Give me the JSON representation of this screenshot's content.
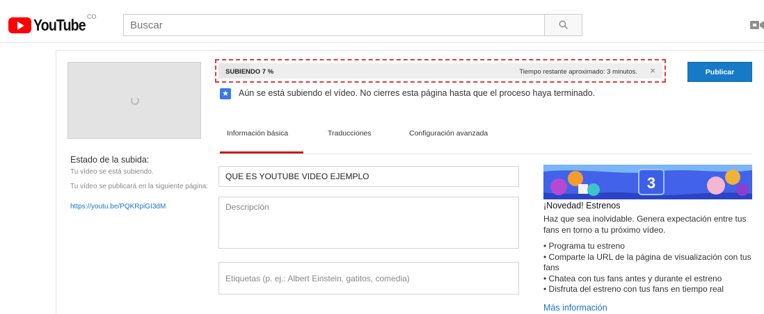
{
  "masthead": {
    "logo_text": "YouTube",
    "country_code": "CO",
    "search_placeholder": "Buscar",
    "search_icon": "search-icon",
    "upload_icon": "video-camera-icon"
  },
  "upload_status": {
    "title": "Estado de la subida:",
    "line1": "Tu vídeo se está subiendo.",
    "line2": "Tu vídeo se publicará en la siguiente página:",
    "link": "https://youtu.be/PQKRpiGI3dM"
  },
  "progress": {
    "label": "SUBIENDO 7 %",
    "percent": 7,
    "remaining": "Tiempo restante aproximado: 3 minutos.",
    "close_glyph": "×"
  },
  "publish_label": "Publicar",
  "notice": {
    "icon": "star-icon",
    "text": "Aún se está subiendo el vídeo. No cierres esta página hasta que el proceso haya terminado."
  },
  "tabs": [
    {
      "label": "Información básica",
      "active": true
    },
    {
      "label": "Traducciones",
      "active": false
    },
    {
      "label": "Configuración avanzada",
      "active": false
    }
  ],
  "form": {
    "title_value": "QUE ES YOUTUBE   VIDEO EJEMPLO",
    "description_placeholder": "Descripción",
    "tags_placeholder": "Etiquetas (p. ej.: Albert Einstein, gatitos, comedia)"
  },
  "promo": {
    "banner_number": "3",
    "title": "¡Novedad! Estrenos",
    "body": "Haz que sea inolvidable. Genera expectación entre tus fans en torno a tu próximo vídeo.",
    "items": [
      "• Programa tu estreno",
      "• Comparte la URL de la página de visualización con tus fans",
      "• Chatea con tus fans antes y durante el estreno",
      "• Disfruta del estreno con tus fans en tiempo real"
    ],
    "link": "Más información"
  },
  "colors": {
    "brand_red": "#ff0000",
    "publish_blue": "#167ac6",
    "tab_underline": "#cc181e",
    "link_blue": "#1a73c8",
    "highlight_dash": "#e23a3a"
  }
}
